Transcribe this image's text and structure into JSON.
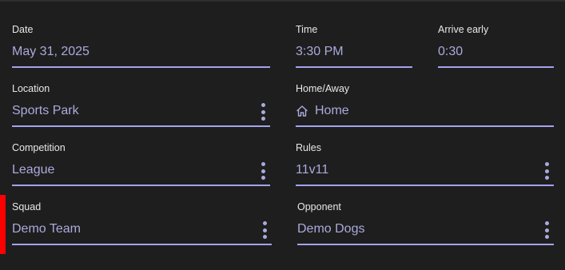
{
  "form": {
    "date": {
      "label": "Date",
      "value": "May 31, 2025"
    },
    "time": {
      "label": "Time",
      "value": "3:30 PM"
    },
    "arrive_early": {
      "label": "Arrive early",
      "value": "0:30"
    },
    "location": {
      "label": "Location",
      "value": "Sports Park"
    },
    "home_away": {
      "label": "Home/Away",
      "value": "Home",
      "icon": "home-icon"
    },
    "competition": {
      "label": "Competition",
      "value": "League"
    },
    "rules": {
      "label": "Rules",
      "value": "11v11"
    },
    "squad": {
      "label": "Squad",
      "value": "Demo Team"
    },
    "opponent": {
      "label": "Opponent",
      "value": "Demo Dogs"
    }
  },
  "colors": {
    "background": "#1e1e1e",
    "label_text": "#e8e8e8",
    "value_text": "#aaaade",
    "underline": "#a3a3ee",
    "error_indicator": "#ff0000"
  }
}
